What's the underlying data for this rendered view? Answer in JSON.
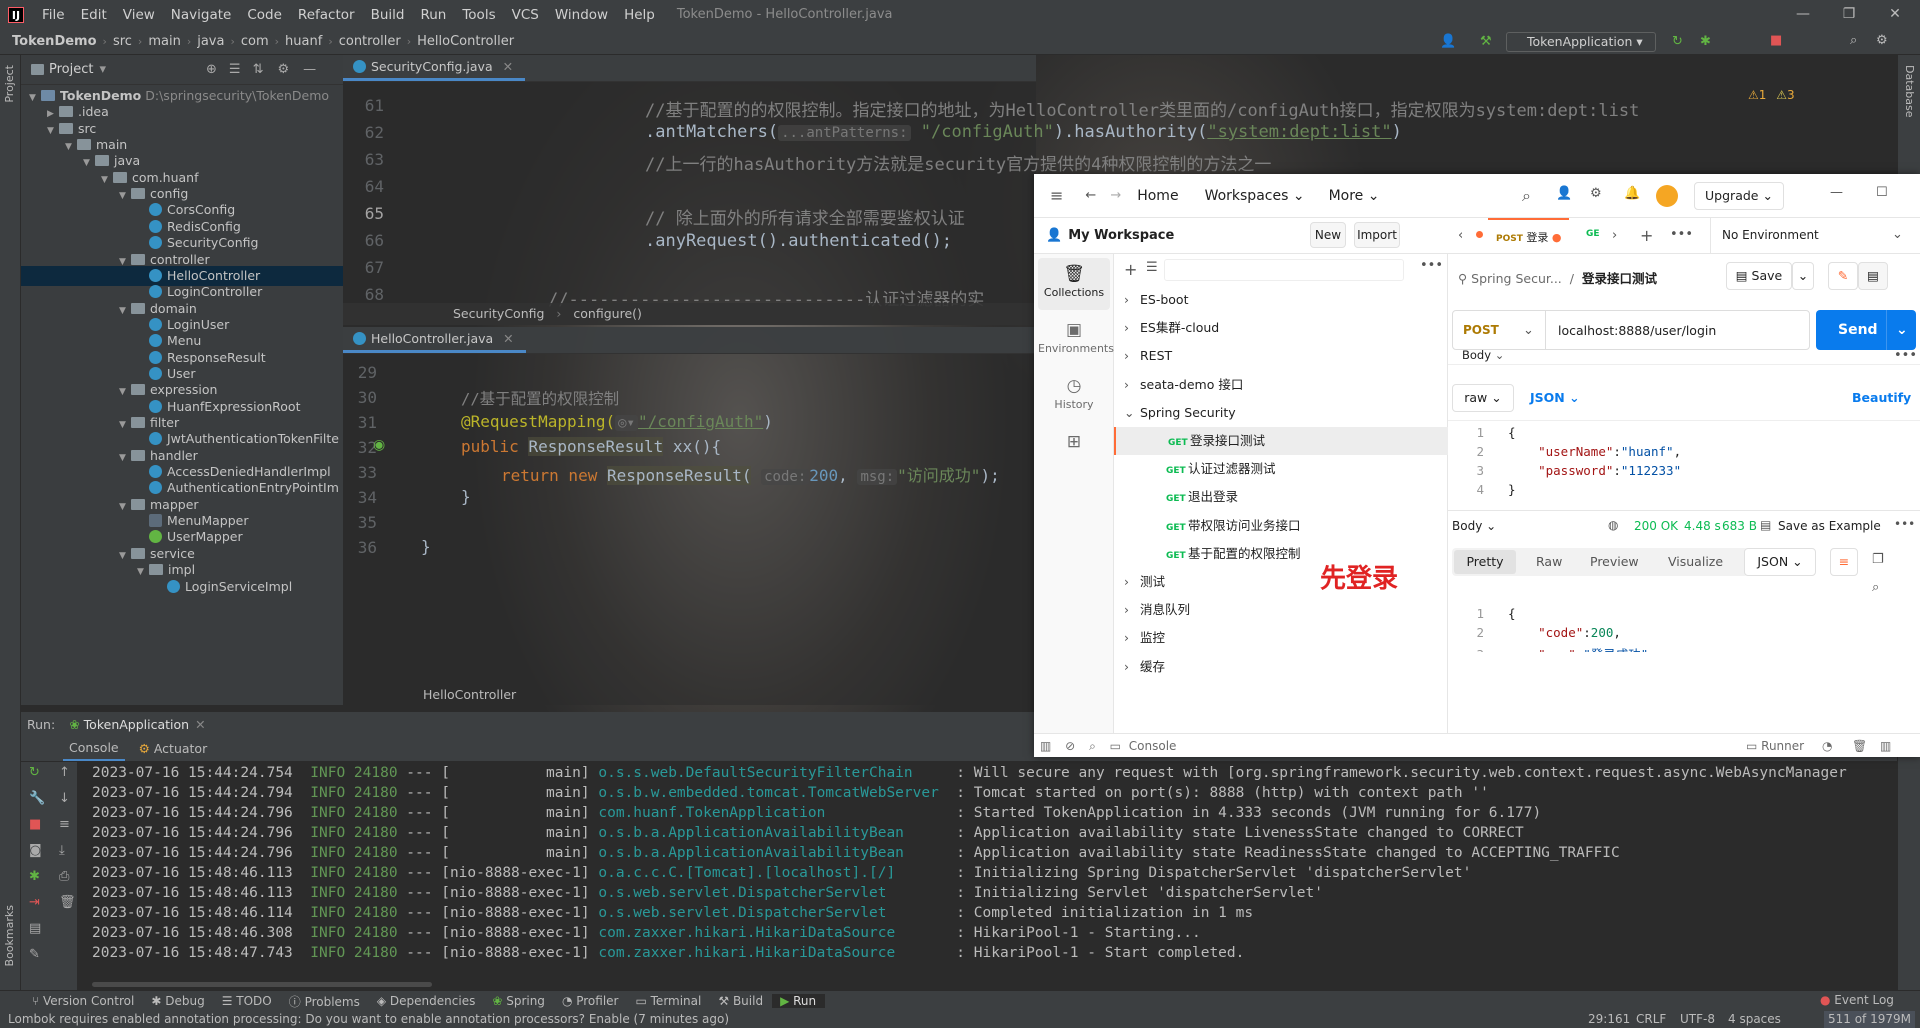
{
  "menubar": {
    "items": [
      "File",
      "Edit",
      "View",
      "Navigate",
      "Code",
      "Refactor",
      "Build",
      "Run",
      "Tools",
      "VCS",
      "Window",
      "Help"
    ],
    "title": "TokenDemo - HelloController.java"
  },
  "navbar": {
    "crumbs": [
      "TokenDemo",
      "src",
      "main",
      "java",
      "com",
      "huanf",
      "controller",
      "HelloController"
    ],
    "run_config": "TokenApplication"
  },
  "stripes": {
    "left_top": "Project",
    "left_bottom": "Bookmarks",
    "right": "Database"
  },
  "project": {
    "header": "Project",
    "tree": [
      {
        "label": "TokenDemo",
        "path": "D:\\springsecurity\\TokenDemo",
        "kind": "module",
        "depth": 0,
        "open": true
      },
      {
        "label": ".idea",
        "kind": "folder",
        "depth": 1,
        "open": false
      },
      {
        "label": "src",
        "kind": "folder",
        "depth": 1,
        "open": true
      },
      {
        "label": "main",
        "kind": "folder",
        "depth": 2,
        "open": true
      },
      {
        "label": "java",
        "kind": "folder",
        "depth": 3,
        "open": true
      },
      {
        "label": "com.huanf",
        "kind": "folder",
        "depth": 4,
        "open": true
      },
      {
        "label": "config",
        "kind": "folder",
        "depth": 5,
        "open": true
      },
      {
        "label": "CorsConfig",
        "kind": "class",
        "depth": 6
      },
      {
        "label": "RedisConfig",
        "kind": "class",
        "depth": 6
      },
      {
        "label": "SecurityConfig",
        "kind": "class",
        "depth": 6
      },
      {
        "label": "controller",
        "kind": "folder",
        "depth": 5,
        "open": true
      },
      {
        "label": "HelloController",
        "kind": "class",
        "depth": 6,
        "selected": true
      },
      {
        "label": "LoginController",
        "kind": "class",
        "depth": 6
      },
      {
        "label": "domain",
        "kind": "folder",
        "depth": 5,
        "open": true
      },
      {
        "label": "LoginUser",
        "kind": "class",
        "depth": 6
      },
      {
        "label": "Menu",
        "kind": "class",
        "depth": 6
      },
      {
        "label": "ResponseResult",
        "kind": "class",
        "depth": 6
      },
      {
        "label": "User",
        "kind": "class",
        "depth": 6
      },
      {
        "label": "expression",
        "kind": "folder",
        "depth": 5,
        "open": true
      },
      {
        "label": "HuanfExpressionRoot",
        "kind": "class",
        "depth": 6
      },
      {
        "label": "filter",
        "kind": "folder",
        "depth": 5,
        "open": true
      },
      {
        "label": "JwtAuthenticationTokenFilte",
        "kind": "class",
        "depth": 6
      },
      {
        "label": "handler",
        "kind": "folder",
        "depth": 5,
        "open": true
      },
      {
        "label": "AccessDeniedHandlerImpl",
        "kind": "class",
        "depth": 6
      },
      {
        "label": "AuthenticationEntryPointIm",
        "kind": "class",
        "depth": 6
      },
      {
        "label": "mapper",
        "kind": "folder",
        "depth": 5,
        "open": true
      },
      {
        "label": "MenuMapper",
        "kind": "mapper",
        "depth": 6
      },
      {
        "label": "UserMapper",
        "kind": "iface",
        "depth": 6
      },
      {
        "label": "service",
        "kind": "folder",
        "depth": 5,
        "open": true
      },
      {
        "label": "impl",
        "kind": "folder",
        "depth": 6,
        "open": true
      },
      {
        "label": "LoginServiceImpl",
        "kind": "class",
        "depth": 7
      }
    ]
  },
  "editor1": {
    "tab": "SecurityConfig.java",
    "inspections": {
      "warnings": "1",
      "weak": "3"
    },
    "lines": [
      {
        "n": "61",
        "text": "//基于配置的的权限控制。指定接口的地址，为HelloController类里面的/configAuth接口，指定权限为system:dept:list"
      },
      {
        "n": "62",
        "text_a": ".antMatchers(",
        "hint": "...antPatterns:",
        "text_str": "\"/configAuth\"",
        "text_b": ").hasAuthority(",
        "text_str2": "\"system:dept:list\"",
        "text_c": ")"
      },
      {
        "n": "63",
        "text": "//上一行的hasAuthority方法就是security官方提供的4种权限控制的方法之一"
      },
      {
        "n": "64",
        "text": ""
      },
      {
        "n": "65",
        "text": "// 除上面外的所有请求全部需要鉴权认证"
      },
      {
        "n": "66",
        "text": ".anyRequest().authenticated();"
      },
      {
        "n": "67",
        "text": ""
      },
      {
        "n": "68",
        "text": "//-----------------------------认证过滤器的实"
      }
    ],
    "breadcrumb": [
      "SecurityConfig",
      "configure()"
    ]
  },
  "editor2": {
    "tab": "HelloController.java",
    "lines": [
      {
        "n": "29"
      },
      {
        "n": "30",
        "text": "//基于配置的权限控制"
      },
      {
        "n": "31",
        "ann": "@RequestMapping(",
        "path": "\"/configAuth\"",
        "close": ")"
      },
      {
        "n": "32",
        "kw": "public",
        "type": "ResponseResult",
        "rest": " xx(){"
      },
      {
        "n": "33",
        "kw": "return new",
        "type": "ResponseResult(",
        "h1": "code:",
        "v1": "200",
        "h2": "msg:",
        "v2": "\"访问成功\"",
        "close": ");"
      },
      {
        "n": "34",
        "text": "}"
      },
      {
        "n": "35",
        "text": ""
      },
      {
        "n": "36",
        "text": "}"
      }
    ],
    "breadcrumb": "HelloController"
  },
  "run": {
    "label": "Run:",
    "config": "TokenApplication",
    "tabs": [
      "Console",
      "Actuator"
    ],
    "log": [
      {
        "ts": "2023-07-16 15:44:24.754",
        "lvl": "INFO",
        "pid": "24180",
        "thr": "--- [           main]",
        "cls": "o.s.s.web.DefaultSecurityFilterChain",
        "msg": ": Will secure any request with [org.springframework.security.web.context.request.async.WebAsyncManager"
      },
      {
        "ts": "2023-07-16 15:44:24.794",
        "lvl": "INFO",
        "pid": "24180",
        "thr": "--- [           main]",
        "cls": "o.s.b.w.embedded.tomcat.TomcatWebServer",
        "msg": ": Tomcat started on port(s): 8888 (http) with context path ''"
      },
      {
        "ts": "2023-07-16 15:44:24.796",
        "lvl": "INFO",
        "pid": "24180",
        "thr": "--- [           main]",
        "cls": "com.huanf.TokenApplication",
        "msg": ": Started TokenApplication in 4.333 seconds (JVM running for 6.177)"
      },
      {
        "ts": "2023-07-16 15:44:24.796",
        "lvl": "INFO",
        "pid": "24180",
        "thr": "--- [           main]",
        "cls": "o.s.b.a.ApplicationAvailabilityBean",
        "msg": ": Application availability state LivenessState changed to CORRECT"
      },
      {
        "ts": "2023-07-16 15:44:24.796",
        "lvl": "INFO",
        "pid": "24180",
        "thr": "--- [           main]",
        "cls": "o.s.b.a.ApplicationAvailabilityBean",
        "msg": ": Application availability state ReadinessState changed to ACCEPTING_TRAFFIC"
      },
      {
        "ts": "2023-07-16 15:48:46.113",
        "lvl": "INFO",
        "pid": "24180",
        "thr": "--- [nio-8888-exec-1]",
        "cls": "o.a.c.c.C.[Tomcat].[localhost].[/]",
        "msg": ": Initializing Spring DispatcherServlet 'dispatcherServlet'"
      },
      {
        "ts": "2023-07-16 15:48:46.113",
        "lvl": "INFO",
        "pid": "24180",
        "thr": "--- [nio-8888-exec-1]",
        "cls": "o.s.web.servlet.DispatcherServlet",
        "msg": ": Initializing Servlet 'dispatcherServlet'"
      },
      {
        "ts": "2023-07-16 15:48:46.114",
        "lvl": "INFO",
        "pid": "24180",
        "thr": "--- [nio-8888-exec-1]",
        "cls": "o.s.web.servlet.DispatcherServlet",
        "msg": ": Completed initialization in 1 ms"
      },
      {
        "ts": "2023-07-16 15:48:46.308",
        "lvl": "INFO",
        "pid": "24180",
        "thr": "--- [nio-8888-exec-1]",
        "cls": "com.zaxxer.hikari.HikariDataSource",
        "msg": ": HikariPool-1 - Starting..."
      },
      {
        "ts": "2023-07-16 15:48:47.743",
        "lvl": "INFO",
        "pid": "24180",
        "thr": "--- [nio-8888-exec-1]",
        "cls": "com.zaxxer.hikari.HikariDataSource",
        "msg": ": HikariPool-1 - Start completed."
      }
    ]
  },
  "toolwindows": [
    "Version Control",
    "Debug",
    "TODO",
    "Problems",
    "Dependencies",
    "Spring",
    "Profiler",
    "Terminal",
    "Build",
    "Run"
  ],
  "event_log": "Event Log",
  "status": {
    "message": "Lombok requires enabled annotation processing: Do you want to enable annotation processors? Enable (7 minutes ago)",
    "pos": "29:161",
    "eol": "CRLF",
    "enc": "UTF-8",
    "indent": "4 spaces",
    "mem": "511 of 1979M"
  },
  "postman": {
    "nav": {
      "home": "Home",
      "workspaces": "Workspaces",
      "more": "More",
      "upgrade": "Upgrade"
    },
    "workspace": "My Workspace",
    "new": "New",
    "import": "Import",
    "side": [
      "Collections",
      "Environments",
      "History"
    ],
    "tabs": {
      "method": "POST",
      "name": "登录",
      "next": "GE",
      "env": "No Environment"
    },
    "collections": [
      {
        "label": "ES-boot",
        "open": false
      },
      {
        "label": "ES集群-cloud",
        "open": false
      },
      {
        "label": "REST",
        "open": false
      },
      {
        "label": "seata-demo 接口",
        "open": false
      },
      {
        "label": "Spring Security",
        "open": true
      }
    ],
    "requests": [
      {
        "method": "GET",
        "label": "登录接口测试",
        "active": true
      },
      {
        "method": "GET",
        "label": "认证过滤器测试"
      },
      {
        "method": "GET",
        "label": "退出登录"
      },
      {
        "method": "GET",
        "label": "带权限访问业务接口"
      },
      {
        "method": "GET",
        "label": "基于配置的权限控制"
      }
    ],
    "collections_after": [
      {
        "label": "测试"
      },
      {
        "label": "消息队列"
      },
      {
        "label": "监控"
      },
      {
        "label": "缓存"
      }
    ],
    "breadcrumb": {
      "parent": "Spring Secur...",
      "sep": "/",
      "current": "登录接口测试"
    },
    "save": "Save",
    "method": "POST",
    "url": "localhost:8888/user/login",
    "send": "Send",
    "body_label": "Body",
    "raw": "raw",
    "json": "JSON",
    "beautify": "Beautify",
    "req_body": [
      {
        "n": "1",
        "t": "{"
      },
      {
        "n": "2",
        "k": "\"userName\"",
        "v": "\"huanf\"",
        "c": ","
      },
      {
        "n": "3",
        "k": "\"password\"",
        "v": "\"112233\""
      },
      {
        "n": "4",
        "t": "}"
      }
    ],
    "response": {
      "label": "Body",
      "status": "200 OK",
      "time": "4.48 s",
      "size": "683 B",
      "save_example": "Save as Example",
      "views": [
        "Pretty",
        "Raw",
        "Preview",
        "Visualize"
      ],
      "format": "JSON",
      "lines": [
        {
          "n": "1",
          "t": "{"
        },
        {
          "n": "2",
          "k": "\"code\"",
          "v": "200",
          "c": ","
        },
        {
          "n": "3",
          "k": "\"msg\"",
          "v": "\"登录成功\""
        }
      ]
    },
    "annotation": "先登录",
    "footer": {
      "console": "Console",
      "runner": "Runner"
    }
  },
  "colors": {
    "accent": "#4a88c7",
    "postman_orange": "#ff6c37",
    "send_blue": "#097bed",
    "annotation_red": "#e02323"
  }
}
